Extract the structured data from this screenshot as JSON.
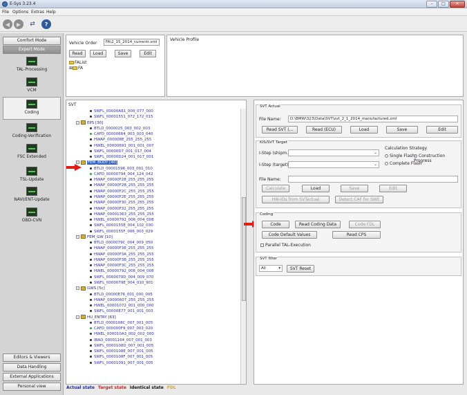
{
  "window": {
    "title": "E-Sys 3.23.4",
    "minimize": "–",
    "maximize": "□",
    "close": "✕"
  },
  "menu": [
    "File",
    "Options",
    "Extras",
    "Help"
  ],
  "toolbar": {
    "back": "◀",
    "forward": "▶",
    "connect": "⇄",
    "help": "?"
  },
  "left_panel": {
    "top_buttons": [
      "Comfort Mode",
      "Expert Mode"
    ],
    "nav": [
      "TAL-Processing",
      "VCM",
      "Coding",
      "Coding-Verification",
      "FSC Extended",
      "TSL-Update",
      "NAVI/ENT-Update",
      "OBD-CVN"
    ],
    "bottom_buttons": [
      "Editors & Viewers",
      "Data Handling",
      "External Applications",
      "Personal view"
    ]
  },
  "vehicle_order": {
    "label": "Vehicle Order",
    "value": "FA\\2_15_2014_currentr.xml",
    "buttons": [
      "Read",
      "Load",
      "Save",
      "Edit"
    ],
    "tree": [
      "FAList",
      "FA"
    ]
  },
  "vehicle_profile": {
    "title": "Vehicle Profile"
  },
  "svt": {
    "title": "SVT",
    "rows": [
      {
        "kind": "unit",
        "text": "SWFL_00000A81_000_077_000",
        "dot": "dark"
      },
      {
        "kind": "unit",
        "text": "SWFL_00001551_072_172_015",
        "dot": "dark"
      },
      {
        "kind": "ecu",
        "text": "EPS [30]",
        "toggle": "-"
      },
      {
        "kind": "unit",
        "text": "BTLD_0000025_003_002_003",
        "dot": "dark"
      },
      {
        "kind": "unit",
        "text": "CAFD_00000684_003_003_040",
        "dot": "green"
      },
      {
        "kind": "unit",
        "text": "HWAP_000008E_255_255_255",
        "dot": "dark"
      },
      {
        "kind": "unit",
        "text": "HWEL_00000691_001_001_007",
        "dot": "dark"
      },
      {
        "kind": "unit",
        "text": "SWFL_00000D7_001_017_004",
        "dot": "dark"
      },
      {
        "kind": "unit",
        "text": "SWFL_00000D24_001_017_001",
        "dot": "dark"
      },
      {
        "kind": "ecu",
        "text": "FEM_BODY [40]",
        "toggle": "-",
        "selected": true
      },
      {
        "kind": "unit",
        "text": "BTLD_00001596_003_001_010",
        "dot": "dark"
      },
      {
        "kind": "unit",
        "text": "CAFD_00000794_004_124_042",
        "dot": "green"
      },
      {
        "kind": "unit",
        "text": "HWAP_00000F28_255_255_255",
        "dot": "dark"
      },
      {
        "kind": "unit",
        "text": "HWAP_00000F2B_255_255_255",
        "dot": "dark"
      },
      {
        "kind": "unit",
        "text": "HWAP_00000F2C_255_255_255",
        "dot": "dark"
      },
      {
        "kind": "unit",
        "text": "HWAP_00000F2E_255_255_255",
        "dot": "dark"
      },
      {
        "kind": "unit",
        "text": "HWAP_00000F30_255_255_255",
        "dot": "dark"
      },
      {
        "kind": "unit",
        "text": "HWAP_00000F32_255_255_255",
        "dot": "dark"
      },
      {
        "kind": "unit",
        "text": "HWAP_00001363_255_255_255",
        "dot": "dark"
      },
      {
        "kind": "unit",
        "text": "HWEL_00000792_006_004_008",
        "dot": "dark"
      },
      {
        "kind": "unit",
        "text": "SWFL_0000155E_004_102_030",
        "dot": "dark"
      },
      {
        "kind": "unit",
        "text": "SWFL_0000155F_006_003_029",
        "dot": "dark"
      },
      {
        "kind": "ecu",
        "text": "FEM_GW [10]",
        "toggle": "-"
      },
      {
        "kind": "unit",
        "text": "BTLD_0000079C_004_009_050",
        "dot": "dark"
      },
      {
        "kind": "unit",
        "text": "HWAP_00000F38_255_255_255",
        "dot": "dark"
      },
      {
        "kind": "unit",
        "text": "HWAP_00000F3A_255_255_255",
        "dot": "dark"
      },
      {
        "kind": "unit",
        "text": "HWAP_00000F3B_255_255_255",
        "dot": "dark"
      },
      {
        "kind": "unit",
        "text": "HWAP_00000F3C_255_255_255",
        "dot": "dark"
      },
      {
        "kind": "unit",
        "text": "HWEL_00000792_006_004_008",
        "dot": "dark"
      },
      {
        "kind": "unit",
        "text": "SWFL_0000079D_004_009_070",
        "dot": "dark"
      },
      {
        "kind": "unit",
        "text": "SWFL_0000079E_004_010_901",
        "dot": "dark"
      },
      {
        "kind": "ecu",
        "text": "GWS [5c]",
        "toggle": "-"
      },
      {
        "kind": "unit",
        "text": "BTLD_00000E76_001_000_005",
        "dot": "dark"
      },
      {
        "kind": "unit",
        "text": "HWAP_00000607_255_255_255",
        "dot": "dark"
      },
      {
        "kind": "unit",
        "text": "HWEL_00001072_001_000_000",
        "dot": "dark"
      },
      {
        "kind": "unit",
        "text": "SWFL_00000E77_001_001_003",
        "dot": "dark"
      },
      {
        "kind": "ecu",
        "text": "HU_ENTRY [63]",
        "toggle": "-"
      },
      {
        "kind": "unit",
        "text": "BTLD_0000108C_007_001_005",
        "dot": "dark"
      },
      {
        "kind": "unit",
        "text": "CAFD_000000F9_007_003_020",
        "dot": "green"
      },
      {
        "kind": "unit",
        "text": "HWEL_000010A3_002_002_000",
        "dot": "dark"
      },
      {
        "kind": "unit",
        "text": "IBAD_00001164_007_001_003",
        "dot": "dark"
      },
      {
        "kind": "unit",
        "text": "SWFL_0000108D_007_001_005",
        "dot": "dark"
      },
      {
        "kind": "unit",
        "text": "SWFL_0000108E_007_001_005",
        "dot": "dark"
      },
      {
        "kind": "unit",
        "text": "SWFL_0000108F_007_001_005",
        "dot": "dark"
      },
      {
        "kind": "unit",
        "text": "SWFL_00001091_007_001_005",
        "dot": "dark"
      }
    ]
  },
  "legend": [
    {
      "text": "Actual state",
      "color": "#1c2aa5"
    },
    {
      "text": "Target state",
      "color": "#d0201e"
    },
    {
      "text": "Identical state",
      "color": "#111111"
    },
    {
      "text": "FDL",
      "color": "#e8a21a"
    }
  ],
  "svt_actual": {
    "title": "SVT Actual",
    "file_label": "File Name:",
    "file_value": "D:\\BMW\\323\\Data\\SVT\\svt_2_1_2014_manufactured.xml",
    "buttons": [
      "Read SVT (...",
      "Read (ECU)",
      "Load",
      "Save",
      "Edit"
    ]
  },
  "kis_target": {
    "title": "KIS/SVT Target",
    "istep_shipm": "I-Step (shipm.):",
    "istep_target": "I-Step (target):",
    "calc_title": "Calculation Strategy",
    "radio_single": "Single Flash",
    "radio_construction": "Construction Progress",
    "radio_complete": "Complete Flash",
    "file_label": "File Name:",
    "buttons": [
      "Calculate",
      "Load",
      "Save",
      "Edit"
    ],
    "buttons2": [
      "HW-IDs from SVTactual",
      "Detect CAF for SWE"
    ]
  },
  "coding": {
    "title": "Coding",
    "row1": [
      "Code",
      "Read Coding Data",
      "Code FDL"
    ],
    "row2": [
      "Code Default Values",
      "Read CPS"
    ],
    "parallel": "Parallel TAL-Execution"
  },
  "svt_filter": {
    "title": "SVT filter",
    "select": "All",
    "reset": "SVT Reset"
  }
}
